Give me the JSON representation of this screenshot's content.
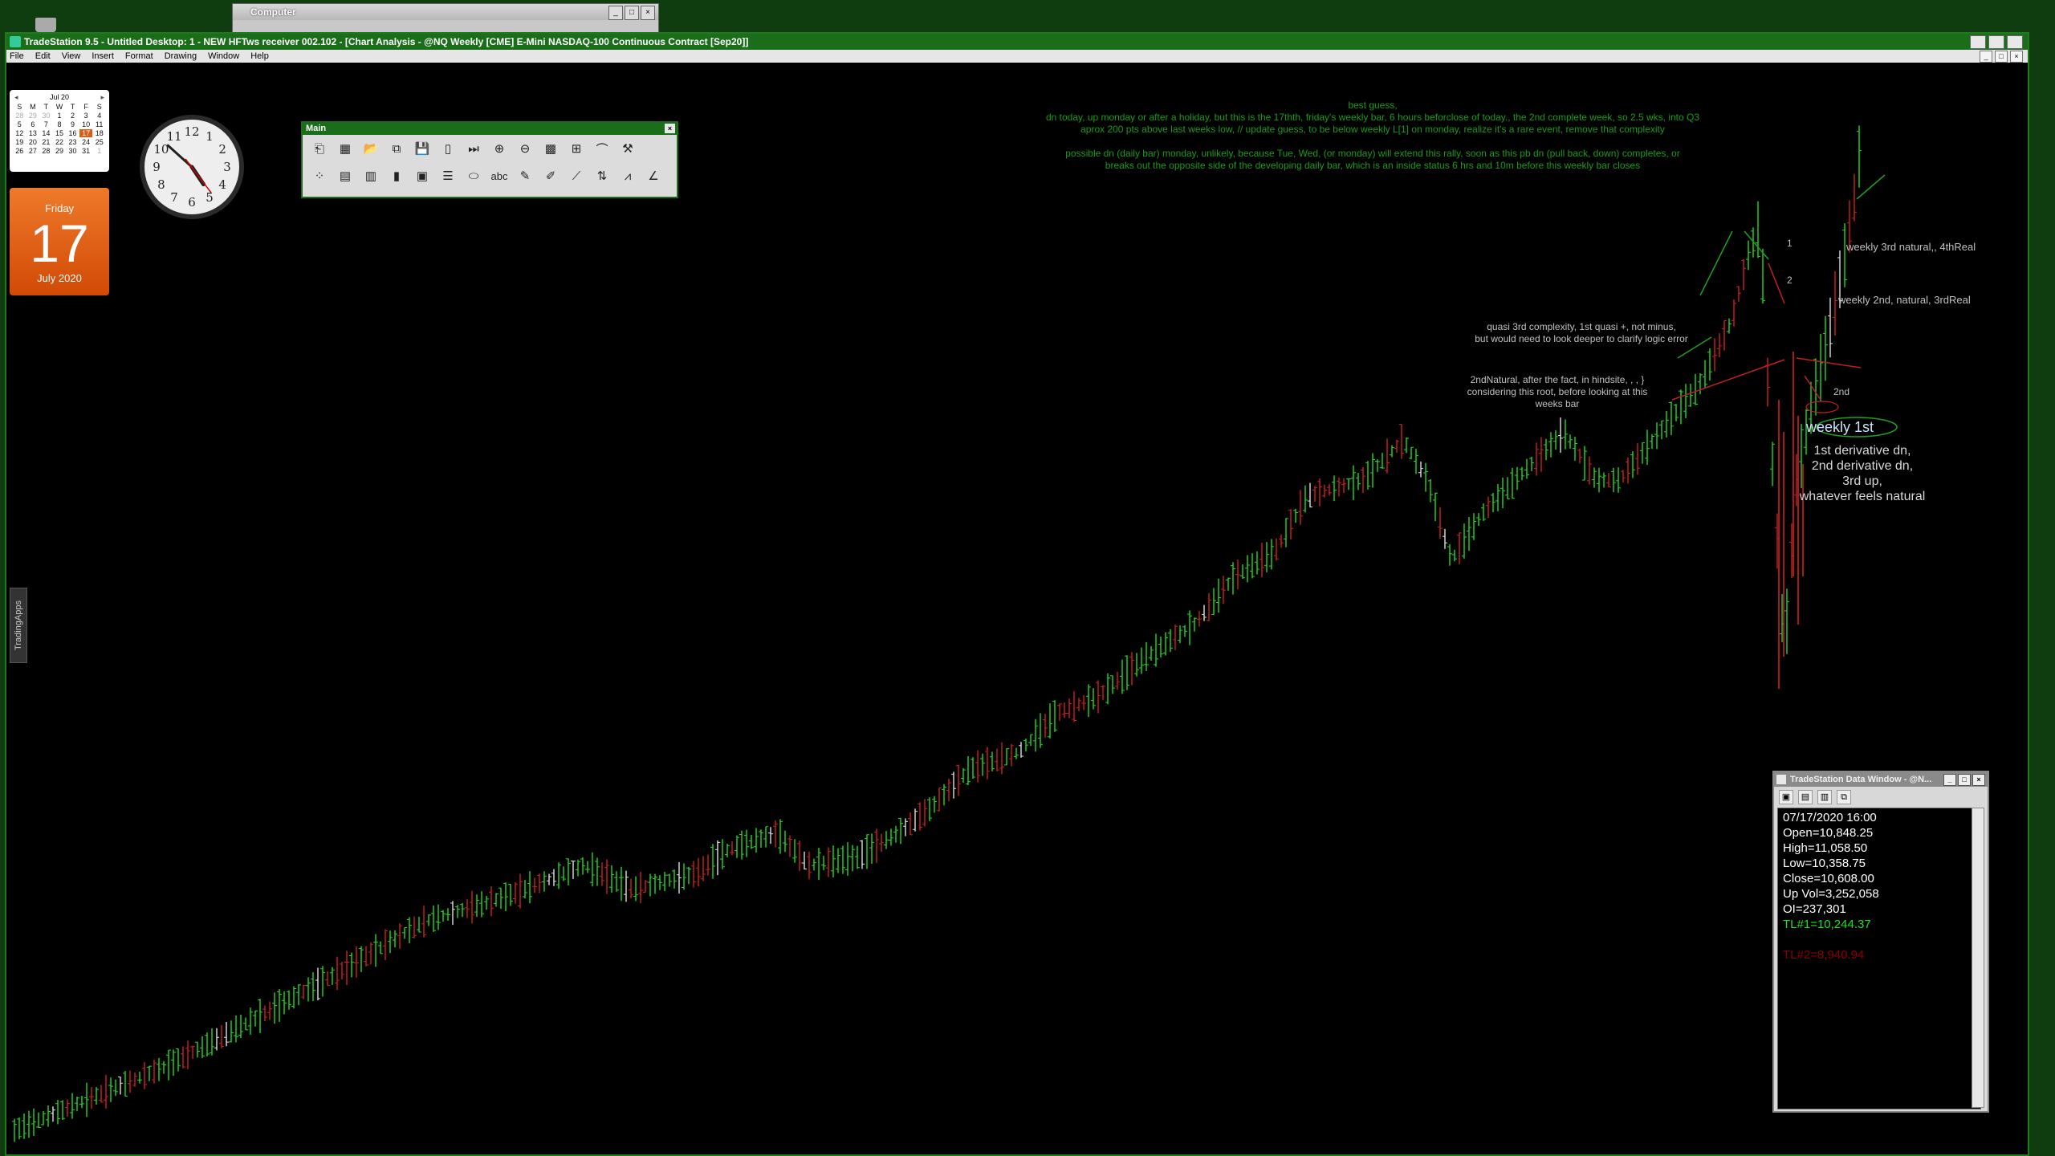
{
  "desktop": {
    "background_window_title": "Computer"
  },
  "main_window": {
    "title": "TradeStation 9.5 - Untitled Desktop: 1 - NEW HFTws receiver 002.102 - [Chart Analysis - @NQ Weekly [CME] E-Mini NASDAQ-100 Continuous Contract [Sep20]]",
    "menu": [
      "File",
      "Edit",
      "View",
      "Insert",
      "Format",
      "Drawing",
      "Window",
      "Help"
    ]
  },
  "side_tab": "TradingApps",
  "calendar": {
    "month_label": "Jul 20",
    "weekdays": [
      "S",
      "M",
      "T",
      "W",
      "T",
      "F",
      "S"
    ],
    "days": [
      "28",
      "29",
      "30",
      "1",
      "2",
      "3",
      "4",
      "5",
      "6",
      "7",
      "8",
      "9",
      "10",
      "11",
      "12",
      "13",
      "14",
      "15",
      "16",
      "17",
      "18",
      "19",
      "20",
      "21",
      "22",
      "23",
      "24",
      "25",
      "26",
      "27",
      "28",
      "29",
      "30",
      "31",
      "1"
    ],
    "date_card": {
      "weekday": "Friday",
      "day": "17",
      "month_year": "July 2020"
    }
  },
  "clock": {
    "numbers": [
      "12",
      "1",
      "2",
      "3",
      "4",
      "5",
      "6",
      "7",
      "8",
      "9",
      "10",
      "11"
    ],
    "time_hour": 4,
    "time_minute": 52
  },
  "toolbar": {
    "title": "Main",
    "icons": [
      "new-chart-icon",
      "table-icon",
      "open-folder-icon",
      "copy-icon",
      "save-icon",
      "document-icon",
      "play-end-icon",
      "zoom-in-icon",
      "zoom-out-icon",
      "chart-type-icon",
      "window-tile-icon",
      "curve-icon",
      "tools-icon",
      "scatter-icon",
      "grid-icon",
      "bar-chart-icon",
      "color-bar-icon",
      "window-icon",
      "lines-icon",
      "oval-icon",
      "text-icon",
      "highlight-icon",
      "pencil-icon",
      "trendline-icon",
      "arrows-icon",
      "fan-icon",
      "angle-icon"
    ],
    "labels": {
      "text_tool": "abc"
    }
  },
  "annotations": {
    "top_green": [
      "best guess,",
      "dn today, up monday or after a holiday, but this is the 17thth, friday's weekly bar, 6 hours beforclose of today., the 2nd complete week, so 2.5 wks, into Q3",
      "aprox 200 pts above last weeks low, // update guess, to be below weekly L[1] on monday, realize it's a rare event, remove that complexity",
      "",
      "possible dn (daily bar) monday, unlikely, because Tue, Wed, (or monday) will extend this rally, soon as this pb dn (pull back, down) completes, or",
      "breaks out the opposite side of the developing daily bar, which is an inside status 6 hrs and 10m before this weekly bar closes"
    ],
    "quasi": [
      "quasi 3rd complexity, 1st quasi +, not minus,",
      "but would need to look deeper to clarify logic error"
    ],
    "second_natural": [
      "2ndNatural, after the fact, in hindsite, , , }",
      "considering this root, before looking at this",
      "weeks bar"
    ],
    "weekly_3rd": "weekly 3rd natural,, 4thReal",
    "weekly_2nd": "weekly 2nd, natural, 3rdReal",
    "label_1": "1",
    "label_2": "2",
    "label_2nd": "2nd",
    "weekly_1st": "weekly 1st",
    "derivative": [
      "1st derivative dn,",
      "2nd derivative dn,",
      "3rd up,",
      "whatever feels natural"
    ]
  },
  "data_window": {
    "title": "TradeStation Data Window - @N...",
    "rows": [
      "07/17/2020 16:00",
      "Open=10,848.25",
      "High=11,058.50",
      "Low=10,358.75",
      "Close=10,608.00",
      "Up Vol=3,252,058",
      "OI=237,301"
    ],
    "tl1": "TL#1=10,244.37",
    "tl2": "TL#2=8,940.94",
    "tl1_color": "#22dd22",
    "tl2_color": "#8a0000"
  },
  "chart_colors": {
    "up": "#1fdc1f",
    "down": "#d02020",
    "neutral": "#e0e0e0",
    "annotation_green": "#1a9a1a"
  }
}
